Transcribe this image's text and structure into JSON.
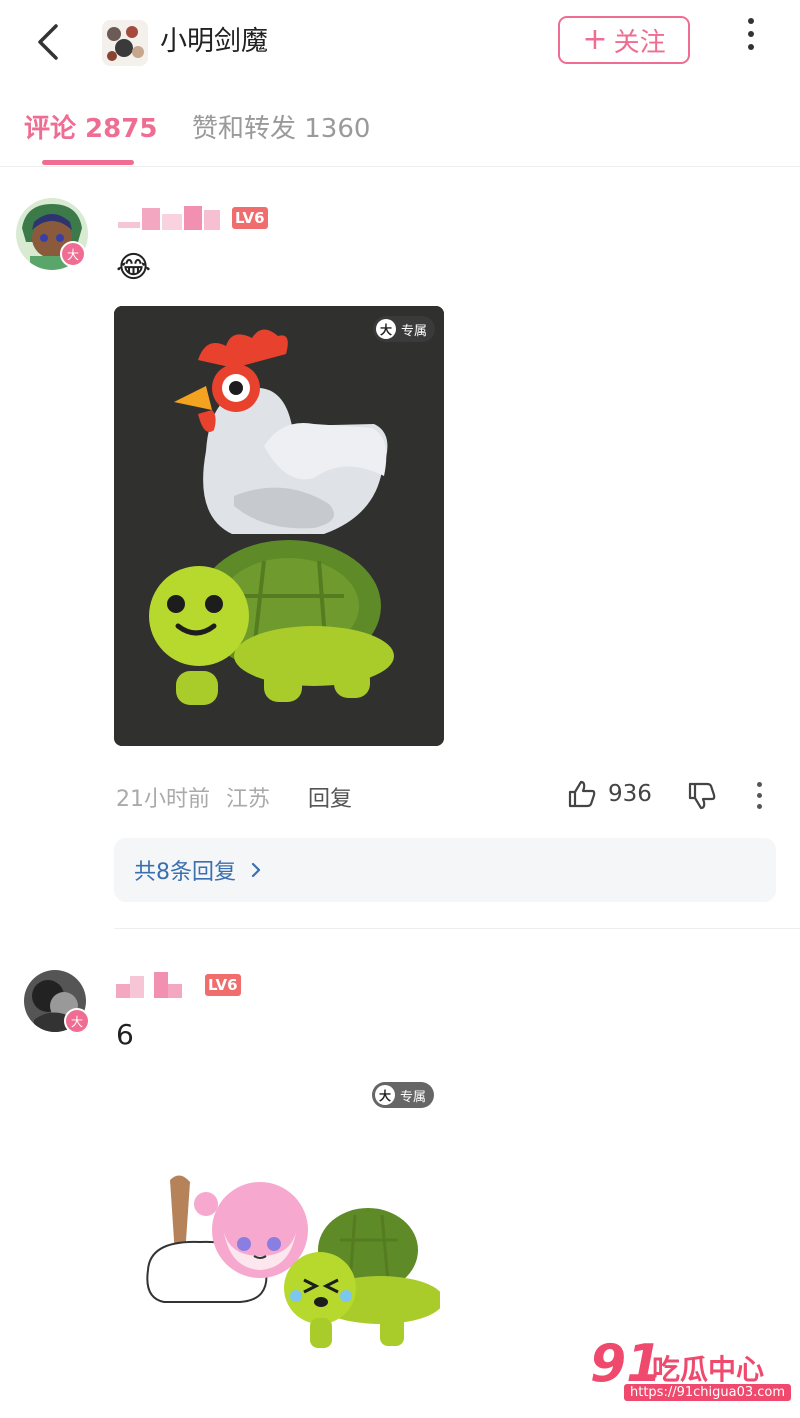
{
  "header": {
    "title": "小明剑魔",
    "follow_label": "关注",
    "follow_plus": "+"
  },
  "tabs": [
    {
      "label": "评论 2875",
      "active": true
    },
    {
      "label": "赞和转发 1360",
      "active": false
    }
  ],
  "comments": [
    {
      "level": "LV6",
      "text_emoji": "😂",
      "image_badge": "专属",
      "image_badge_letter": "大",
      "time": "21小时前",
      "location": "江苏",
      "reply_label": "回复",
      "likes": "936",
      "replies_summary": "共8条回复"
    },
    {
      "level": "LV6",
      "text": "6",
      "image_badge": "专属",
      "image_badge_letter": "大"
    }
  ],
  "avatar_badge": "大",
  "watermark": {
    "brand_number": "91",
    "brand_text": "吃瓜中心",
    "url": "https://91chigua03.com"
  },
  "colors": {
    "accent": "#ef6d93",
    "level_badge": "#f06d6d",
    "link": "#3a6fb0"
  }
}
